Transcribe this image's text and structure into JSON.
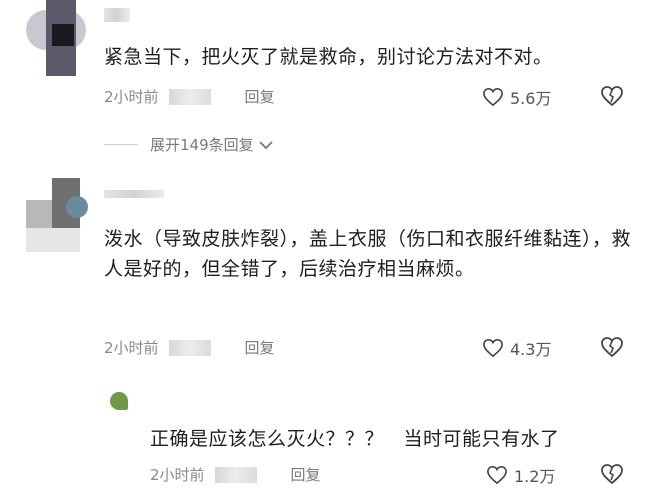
{
  "comments": [
    {
      "text": "紧急当下，把火灭了就是救命，别讨论方法对不对。",
      "time": "2小时前",
      "reply": "回复",
      "likes": "5.6万"
    },
    {
      "text": "泼水（导致皮肤炸裂），盖上衣服（伤口和衣服纤维黏连），救人是好的，但全错了，后续治疗相当麻烦。",
      "time": "2小时前",
      "reply": "回复",
      "likes": "4.3万"
    },
    {
      "text": "正确是应该怎么灭火？？？　当时可能只有水了",
      "time": "2小时前",
      "reply": "回复",
      "likes": "1.2万"
    }
  ],
  "expand_replies": "展开149条回复",
  "icons": [
    "heart-icon",
    "dislike-heart-icon",
    "chevron-down-icon"
  ]
}
